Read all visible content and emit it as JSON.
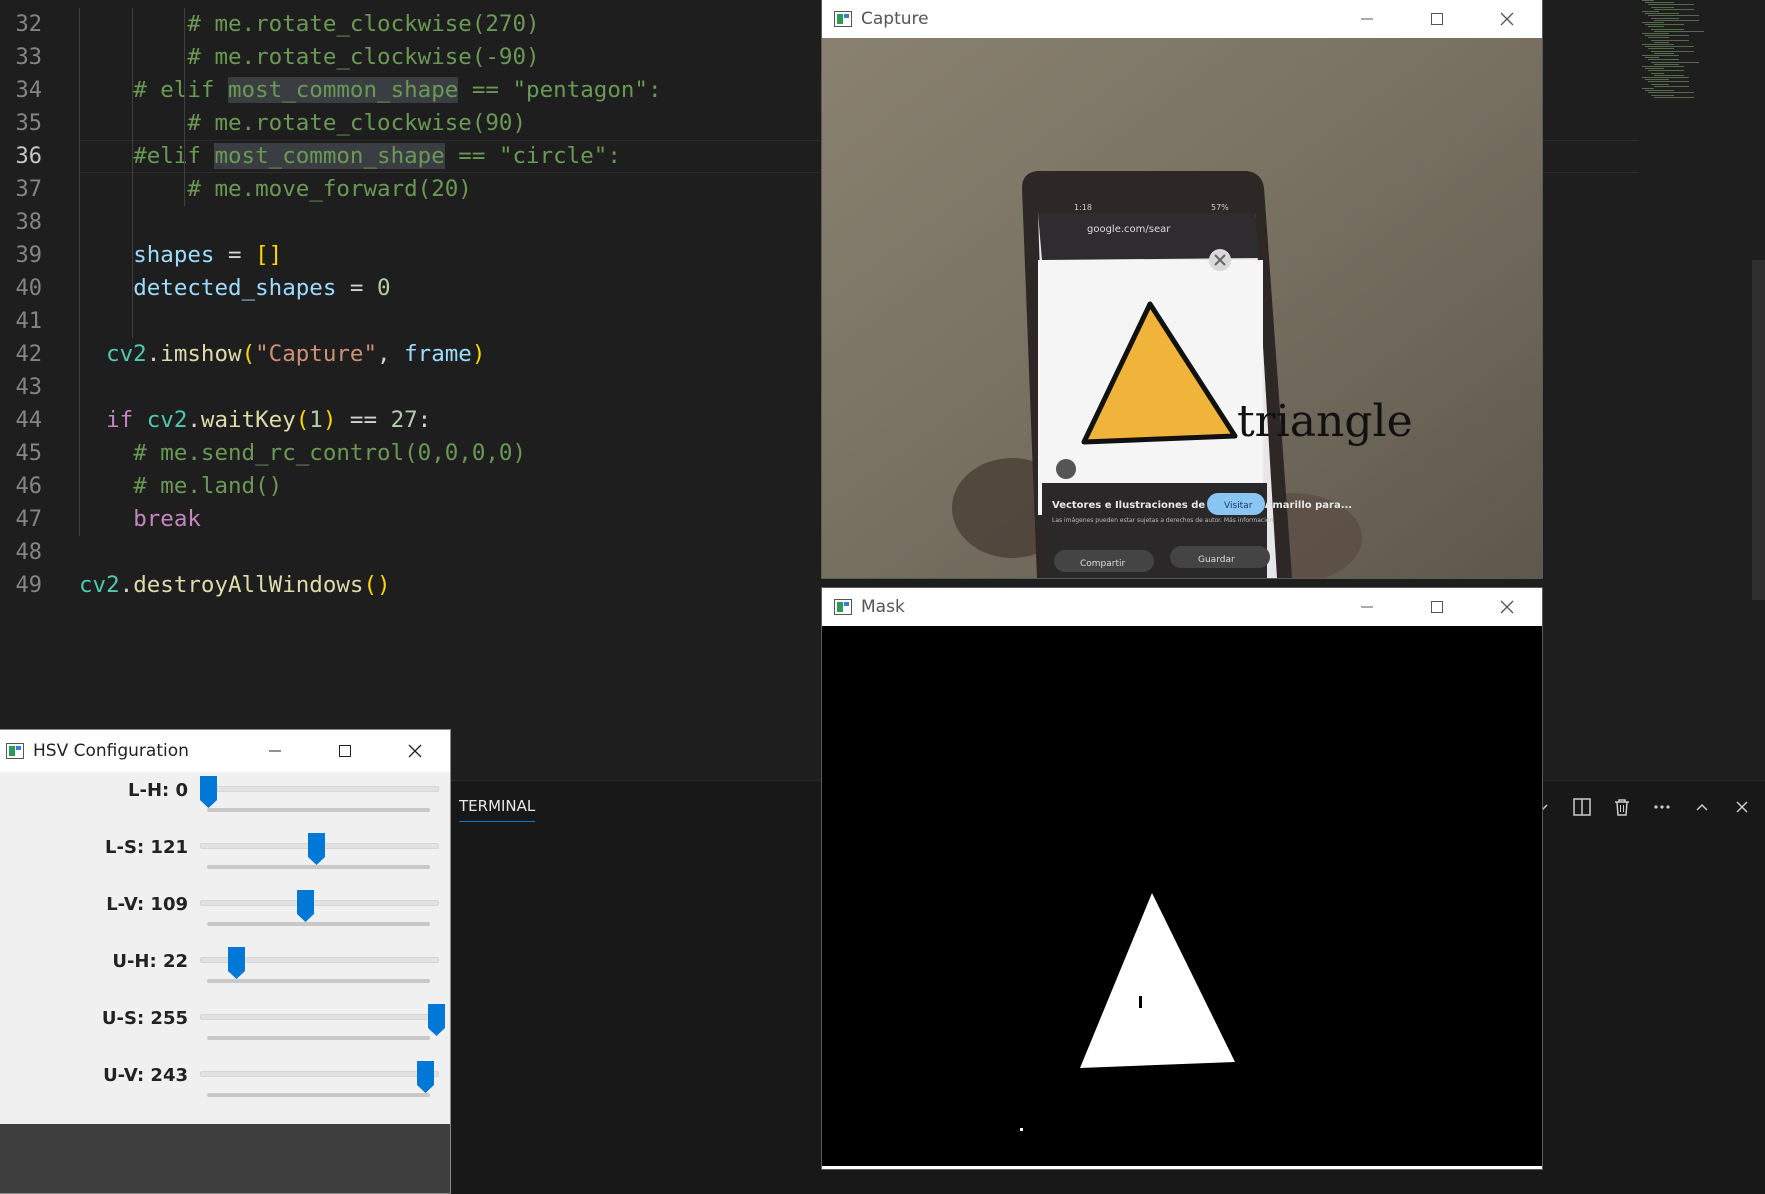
{
  "editor": {
    "lines": [
      {
        "num": "32",
        "active": false,
        "html": "        <span class=\"c\"># me.rotate_clockwise(270)</span>"
      },
      {
        "num": "33",
        "active": false,
        "html": "        <span class=\"c\"># me.rotate_clockwise(-90)</span>"
      },
      {
        "num": "34",
        "active": false,
        "html": "    <span class=\"c\"># elif <span class=\"hl\">most_common_shape</span> == \"pentagon\":</span>"
      },
      {
        "num": "35",
        "active": false,
        "html": "        <span class=\"c\"># me.rotate_clockwise(90)</span>"
      },
      {
        "num": "36",
        "active": true,
        "html": "    <span class=\"c\">#elif <span class=\"hl\">most_common_shape</span> == \"circle\":</span>"
      },
      {
        "num": "37",
        "active": false,
        "html": "        <span class=\"c\"># me.move_forward(20)</span>"
      },
      {
        "num": "38",
        "active": false,
        "html": ""
      },
      {
        "num": "39",
        "active": false,
        "html": "    <span class=\"v\">shapes</span> = <span class=\"b\">[]</span>"
      },
      {
        "num": "40",
        "active": false,
        "html": "    <span class=\"v\">detected_shapes</span> = <span class=\"n\">0</span>"
      },
      {
        "num": "41",
        "active": false,
        "html": ""
      },
      {
        "num": "42",
        "active": false,
        "html": "  <span class=\"m\">cv2</span>.<span class=\"f\">imshow</span><span class=\"b\">(</span><span class=\"s\">\"Capture\"</span>, <span class=\"v\">frame</span><span class=\"b\">)</span>"
      },
      {
        "num": "43",
        "active": false,
        "html": ""
      },
      {
        "num": "44",
        "active": false,
        "html": "  <span class=\"k\">if</span> <span class=\"m\">cv2</span>.<span class=\"f\">waitKey</span><span class=\"b\">(</span><span class=\"n\">1</span><span class=\"b\">)</span> == <span class=\"n\">27</span>:"
      },
      {
        "num": "45",
        "active": false,
        "html": "    <span class=\"c\"># me.send_rc_control(0,0,0,0)</span>"
      },
      {
        "num": "46",
        "active": false,
        "html": "    <span class=\"c\"># me.land()</span>"
      },
      {
        "num": "47",
        "active": false,
        "html": "    <span class=\"k\">break</span>"
      },
      {
        "num": "48",
        "active": false,
        "html": ""
      },
      {
        "num": "49",
        "active": false,
        "html": "<span class=\"m\">cv2</span>.<span class=\"f\">destroyAllWindows</span><span class=\"b\">()</span>"
      }
    ]
  },
  "terminal": {
    "tab_label": "TERMINAL",
    "actions": [
      "chevron-down-icon",
      "split-terminal-icon",
      "trash-icon",
      "more-icon",
      "maximize-panel-icon",
      "close-panel-icon"
    ]
  },
  "capture_window": {
    "title": "Capture",
    "overlay_label": "triangle",
    "phone_status_time": "1:18",
    "phone_url": "google.com/sear",
    "phone_battery": "57%",
    "phone_caption_title": "Vectores e Ilustraciones de Triangulo Amarillo para...",
    "phone_caption_sub": "Las imágenes pueden estar sujetas a derechos de autor. Más información",
    "phone_visit": "Visitar",
    "phone_share": "Compartir",
    "phone_save": "Guardar"
  },
  "mask_window": {
    "title": "Mask"
  },
  "hsv_window": {
    "title": "HSV Configuration",
    "sliders": [
      {
        "label": "L-H: 0",
        "value": 0,
        "max": 179
      },
      {
        "label": "L-S: 121",
        "value": 121,
        "max": 255
      },
      {
        "label": "L-V: 109",
        "value": 109,
        "max": 255
      },
      {
        "label": "U-H: 22",
        "value": 22,
        "max": 179
      },
      {
        "label": "U-S: 255",
        "value": 255,
        "max": 255
      },
      {
        "label": "U-V: 243",
        "value": 243,
        "max": 255
      }
    ]
  },
  "colors": {
    "editor_bg": "#1e1e1e",
    "comment": "#6a9955",
    "thumb": "#0078d7",
    "accent": "#0078d4"
  }
}
